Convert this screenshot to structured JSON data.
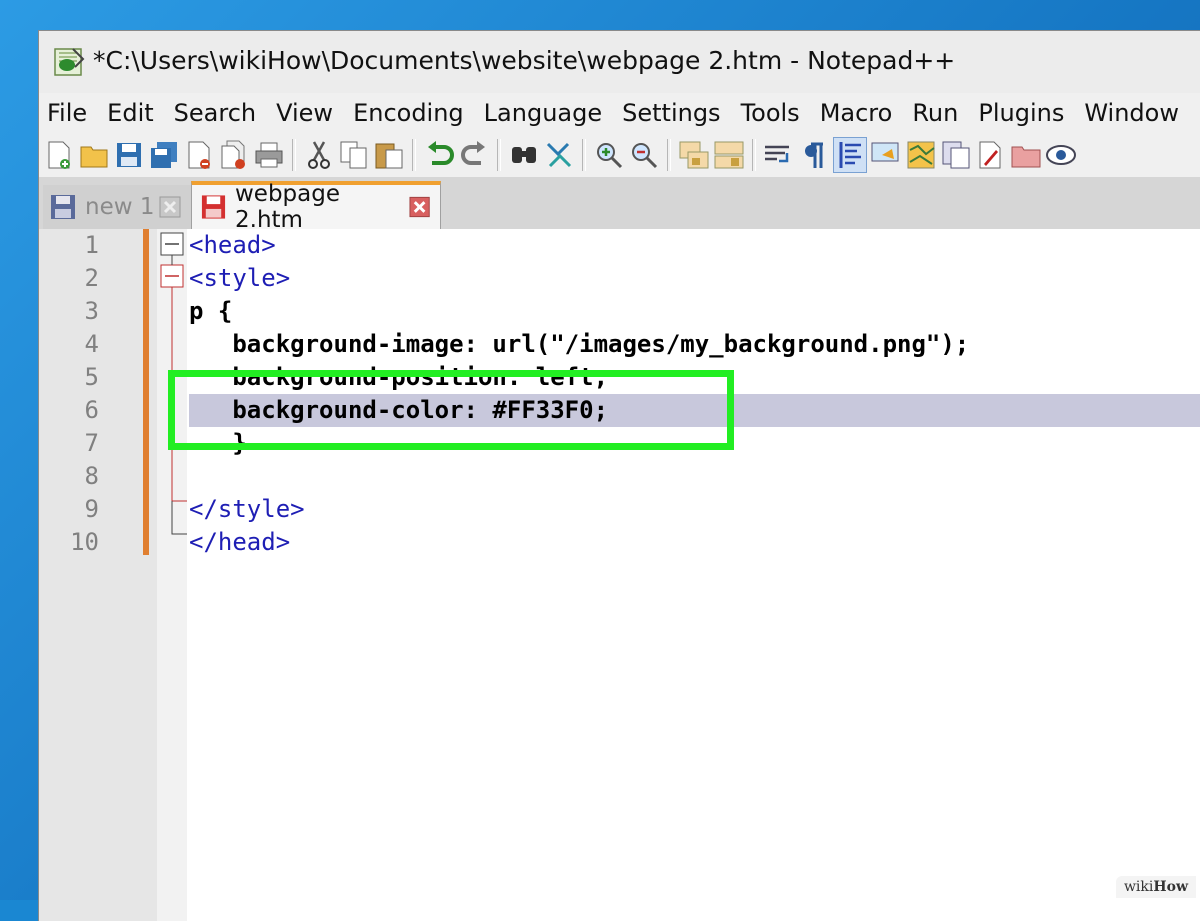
{
  "window": {
    "title": "*C:\\Users\\wikiHow\\Documents\\website\\webpage 2.htm - Notepad++"
  },
  "menu": [
    "File",
    "Edit",
    "Search",
    "View",
    "Encoding",
    "Language",
    "Settings",
    "Tools",
    "Macro",
    "Run",
    "Plugins",
    "Window",
    "?"
  ],
  "toolbar": {
    "buttons": [
      "new-file-icon",
      "open-file-icon",
      "save-icon",
      "save-all-icon",
      "close-icon",
      "close-all-icon",
      "print-icon",
      "cut-icon",
      "copy-icon",
      "paste-icon",
      "undo-icon",
      "redo-icon",
      "find-icon",
      "replace-icon",
      "zoom-in-icon",
      "zoom-out-icon",
      "sync-vertical-icon",
      "sync-horizontal-icon",
      "word-wrap-icon",
      "show-all-chars-icon",
      "indent-guide-icon",
      "user-defined-language-icon",
      "document-map-icon",
      "function-list-icon",
      "folder-as-workspace-icon",
      "record-macro-icon",
      "monitoring-icon"
    ]
  },
  "tabs": [
    {
      "label": "new 1",
      "active": false
    },
    {
      "label": "webpage 2.htm",
      "active": true
    }
  ],
  "editor": {
    "line_numbers": [
      "1",
      "2",
      "3",
      "4",
      "5",
      "6",
      "7",
      "8",
      "9",
      "10"
    ],
    "lines": [
      {
        "text": "<head>",
        "kind": "tag"
      },
      {
        "text": "<style>",
        "kind": "tag"
      },
      {
        "text": "p {",
        "kind": "prop"
      },
      {
        "text": "   background-image: url(\"/images/my_background.png\");",
        "kind": "prop"
      },
      {
        "text": "   background-position: left;",
        "kind": "prop"
      },
      {
        "text": "   background-color: #FF33F0;",
        "kind": "prop"
      },
      {
        "text": "   }",
        "kind": "prop"
      },
      {
        "text": "",
        "kind": "prop"
      },
      {
        "text": "</style>",
        "kind": "tag"
      },
      {
        "text": "</head>",
        "kind": "tag"
      }
    ],
    "current_line": 6
  },
  "colors": {
    "highlight_box": "#22ee22",
    "tag_text": "#1e1eb4",
    "modified_bar": "#e07f30"
  },
  "watermark": {
    "prefix": "wiki",
    "suffix": "How"
  }
}
